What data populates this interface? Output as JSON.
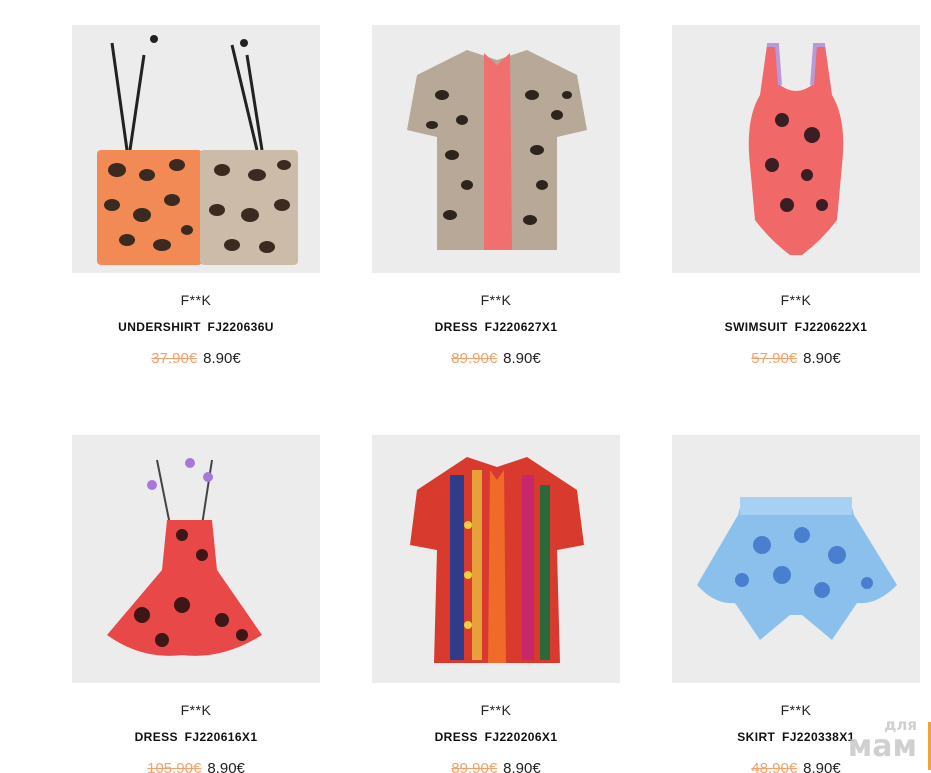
{
  "products": [
    {
      "brand": "F**K",
      "name": "UNDERSHIRT  FJ220636U",
      "old_price": "37.90€",
      "new_price": "8.90€",
      "image": "leopard-crop-top"
    },
    {
      "brand": "F**K",
      "name": "DRESS  FJ220627X1",
      "old_price": "89.90€",
      "new_price": "8.90€",
      "image": "leopard-shirt-dress"
    },
    {
      "brand": "F**K",
      "name": "SWIMSUIT  FJ220622X1",
      "old_price": "57.90€",
      "new_price": "8.90€",
      "image": "floral-swimsuit"
    },
    {
      "brand": "F**K",
      "name": "DRESS  FJ220616X1",
      "old_price": "105.90€",
      "new_price": "8.90€",
      "image": "floral-ruffle-dress"
    },
    {
      "brand": "F**K",
      "name": "DRESS  FJ220206X1",
      "old_price": "89.90€",
      "new_price": "8.90€",
      "image": "patterned-shirt-dress"
    },
    {
      "brand": "F**K",
      "name": "SKIRT  FJ220338X1",
      "old_price": "48.90€",
      "new_price": "8.90€",
      "image": "blue-floral-skirt"
    }
  ],
  "watermark": {
    "small": "для",
    "big": "мам"
  },
  "colors": {
    "old_price": "#f0a26b",
    "thumb_bg": "#ececec",
    "accent_tab": "#f2a23a"
  }
}
